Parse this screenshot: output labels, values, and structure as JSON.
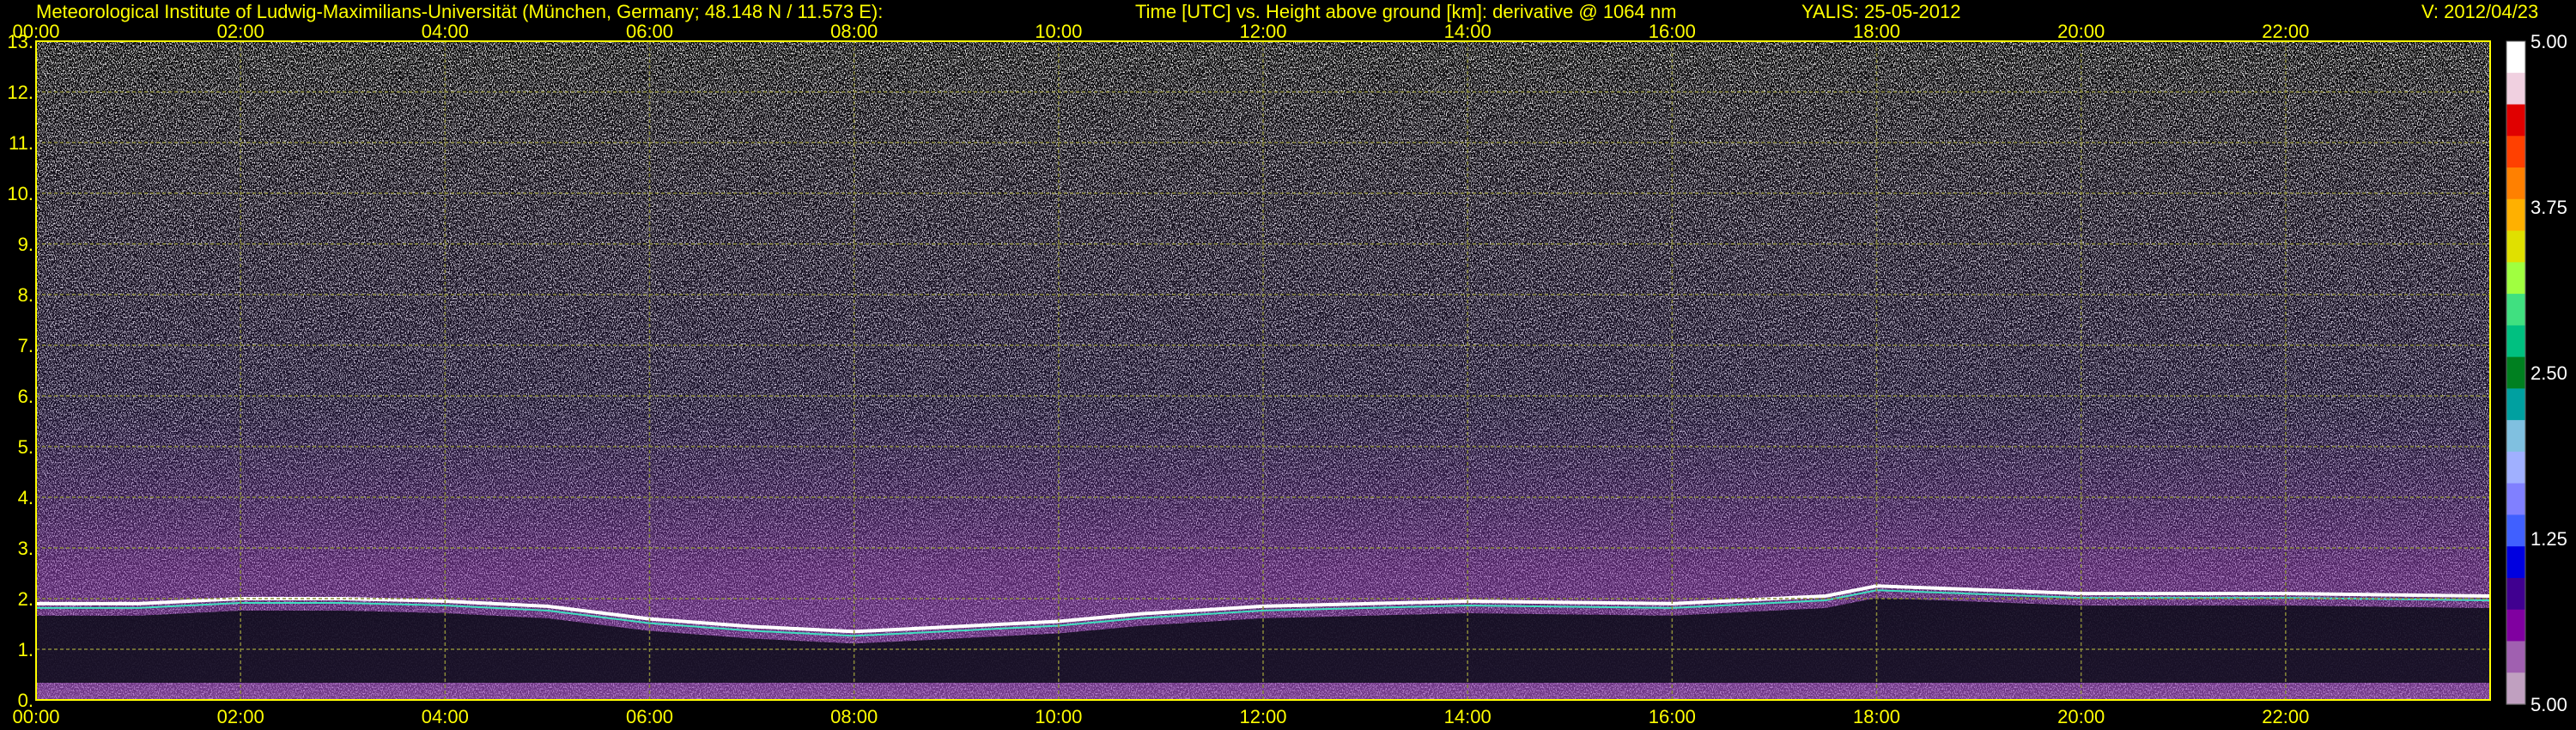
{
  "header": {
    "institute": "Meteorological Institute of Ludwig-Maximilians-Universität (München, Germany; 48.148 N / 11.573 E):",
    "description": "Time [UTC] vs. Height above ground [km]: derivative @ 1064 nm",
    "station_date": "YALIS: 25-05-2012",
    "version": "V: 2012/04/23"
  },
  "colors": {
    "axis": "#ffff00",
    "background": "#000000",
    "grid": "#8a8a3a"
  },
  "chart_data": {
    "type": "heatmap",
    "x_ticks": [
      "00:00",
      "02:00",
      "04:00",
      "06:00",
      "08:00",
      "10:00",
      "12:00",
      "14:00",
      "16:00",
      "18:00",
      "20:00",
      "22:00"
    ],
    "x_range_hours": [
      0,
      24
    ],
    "y_ticks": [
      "0.",
      "1.",
      "2.",
      "3.",
      "4.",
      "5.",
      "6.",
      "7.",
      "8.",
      "9.",
      "10.",
      "11.",
      "12.",
      "13."
    ],
    "y_range_km": [
      0,
      13
    ],
    "grid": true,
    "colorbar": {
      "ticks": [
        "5.00",
        "3.75",
        "2.50",
        "1.25",
        "5.00"
      ],
      "colors": [
        "#ffffff",
        "#f0d0e0",
        "#e00000",
        "#ff4000",
        "#ff8000",
        "#ffb000",
        "#e0e000",
        "#a0ff40",
        "#40e080",
        "#00c080",
        "#008020",
        "#00a0a0",
        "#80c0e0",
        "#a0b0ff",
        "#8080ff",
        "#4060ff",
        "#0000e0",
        "#400090",
        "#8000a0",
        "#a060b0",
        "#c0a0c0"
      ]
    },
    "features": {
      "layer_top_hours": [
        0,
        1,
        2,
        3,
        4,
        5,
        6,
        7,
        8,
        9,
        10,
        10.8,
        12,
        14,
        16,
        17.5,
        18,
        20,
        22,
        24
      ],
      "layer_top_km": [
        1.9,
        1.9,
        2.0,
        2.0,
        1.95,
        1.85,
        1.6,
        1.45,
        1.35,
        1.45,
        1.55,
        1.7,
        1.85,
        1.95,
        1.9,
        2.05,
        2.25,
        2.1,
        2.1,
        2.05
      ]
    }
  }
}
